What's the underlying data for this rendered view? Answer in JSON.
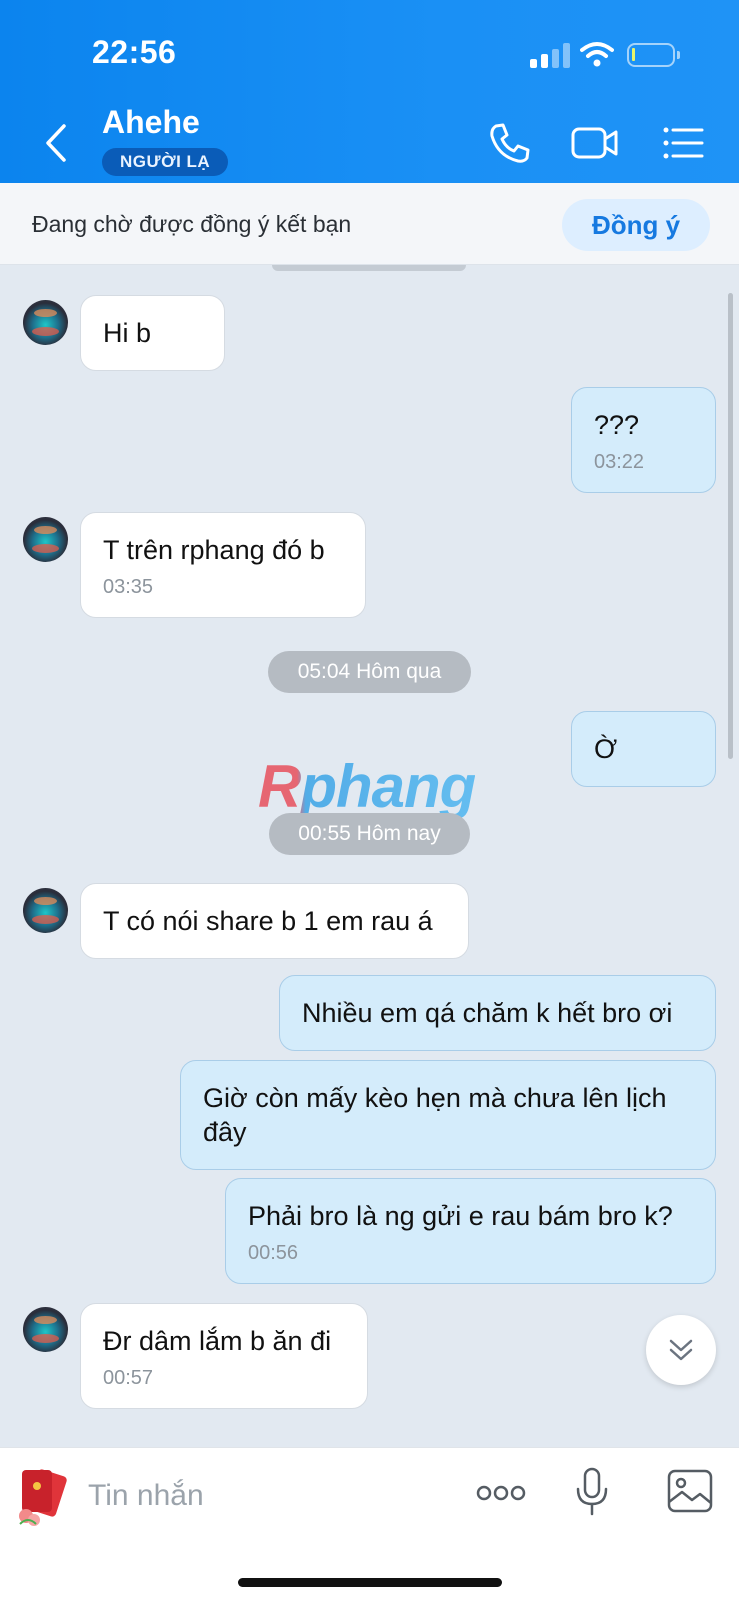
{
  "status_bar": {
    "time": "22:56"
  },
  "header": {
    "title": "Ahehe",
    "badge": "NGƯỜI LẠ"
  },
  "friend_request": {
    "text": "Đang chờ được đồng ý kết bạn",
    "accept_label": "Đồng ý"
  },
  "messages": [
    {
      "side": "in",
      "text": "Hi b",
      "time": ""
    },
    {
      "side": "out",
      "text": "???",
      "time": "03:22"
    },
    {
      "side": "in",
      "text": "T trên rphang đó b",
      "time": "03:35"
    },
    {
      "side": "out",
      "text": "Ờ",
      "time": ""
    },
    {
      "side": "in",
      "text": "T có nói share b 1 em rau á",
      "time": ""
    },
    {
      "side": "out",
      "text": "Nhiều em qá chăm k hết bro ơi",
      "time": ""
    },
    {
      "side": "out",
      "text": "Giờ còn mấy kèo hẹn mà chưa lên lịch đây",
      "time": ""
    },
    {
      "side": "out",
      "text": "Phải bro là ng gửi e rau bám bro k?",
      "time": "00:56"
    },
    {
      "side": "in",
      "text": "Đr dâm lắm b ăn đi",
      "time": "00:57"
    }
  ],
  "date_separators": [
    "05:04 Hôm qua",
    "00:55 Hôm nay"
  ],
  "watermark": "Rphang",
  "composer": {
    "placeholder": "Tin nhắn"
  },
  "colors": {
    "header": "#1a8df3",
    "incoming_bubble": "#ffffff",
    "outgoing_bubble": "#d4ecfb",
    "accent": "#1679e0"
  },
  "icons": [
    "back-icon",
    "phone-icon",
    "video-call-icon",
    "menu-list-icon",
    "chevron-double-down-icon",
    "sticker-icon",
    "more-dots-icon",
    "microphone-icon",
    "image-icon"
  ]
}
